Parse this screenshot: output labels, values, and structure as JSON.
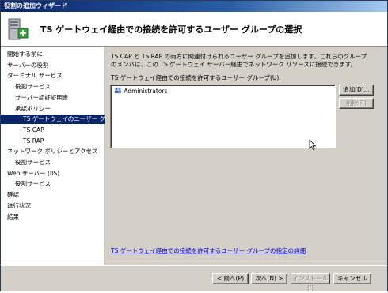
{
  "window": {
    "title": "役割の追加ウィザード"
  },
  "header": {
    "title": "TS ゲートウェイ経由での接続を許可するユーザー グループの選択"
  },
  "sidebar": {
    "items": [
      {
        "label": "開始する前に",
        "indent": 0,
        "selected": false
      },
      {
        "label": "サーバーの役割",
        "indent": 0,
        "selected": false
      },
      {
        "label": "ターミナル サービス",
        "indent": 0,
        "selected": false
      },
      {
        "label": "役割サービス",
        "indent": 1,
        "selected": false
      },
      {
        "label": "サーバー認証証明書",
        "indent": 1,
        "selected": false
      },
      {
        "label": "承認ポリシー",
        "indent": 1,
        "selected": false
      },
      {
        "label": "TS ゲートウェイのユーザー グ...",
        "indent": 2,
        "selected": true
      },
      {
        "label": "TS CAP",
        "indent": 2,
        "selected": false
      },
      {
        "label": "TS RAP",
        "indent": 2,
        "selected": false
      },
      {
        "label": "ネットワーク ポリシーとアクセス サービ...",
        "indent": 0,
        "selected": false
      },
      {
        "label": "役割サービス",
        "indent": 1,
        "selected": false
      },
      {
        "label": "Web サーバー (IIS)",
        "indent": 0,
        "selected": false
      },
      {
        "label": "役割サービス",
        "indent": 1,
        "selected": false
      },
      {
        "label": "確認",
        "indent": 0,
        "selected": false
      },
      {
        "label": "進行状況",
        "indent": 0,
        "selected": false
      },
      {
        "label": "結果",
        "indent": 0,
        "selected": false
      }
    ]
  },
  "main": {
    "description": "TS CAP と TS RAP の両方に関連付けられるユーザー グループを追加します。これらのグループのメンバは、この TS ゲートウェイ サーバー経由でネットワーク リソースに接続できます。",
    "list_label": "TS ゲートウェイ経由での接続を許可するユーザー グループ(U):",
    "groups": [
      "Administrators"
    ],
    "add_button": "追加(D)...",
    "remove_button": "削除(R)",
    "help_link": "TS ゲートウェイ経由での接続を許可するユーザー グループの指定の詳細"
  },
  "footer": {
    "back": "< 前へ(P)",
    "next": "次へ(N) >",
    "install": "インストール(I)",
    "cancel": "キャンセル"
  },
  "colors": {
    "selection": "#0a246a",
    "link": "#0000cc",
    "dialog": "#d4d0c8"
  }
}
